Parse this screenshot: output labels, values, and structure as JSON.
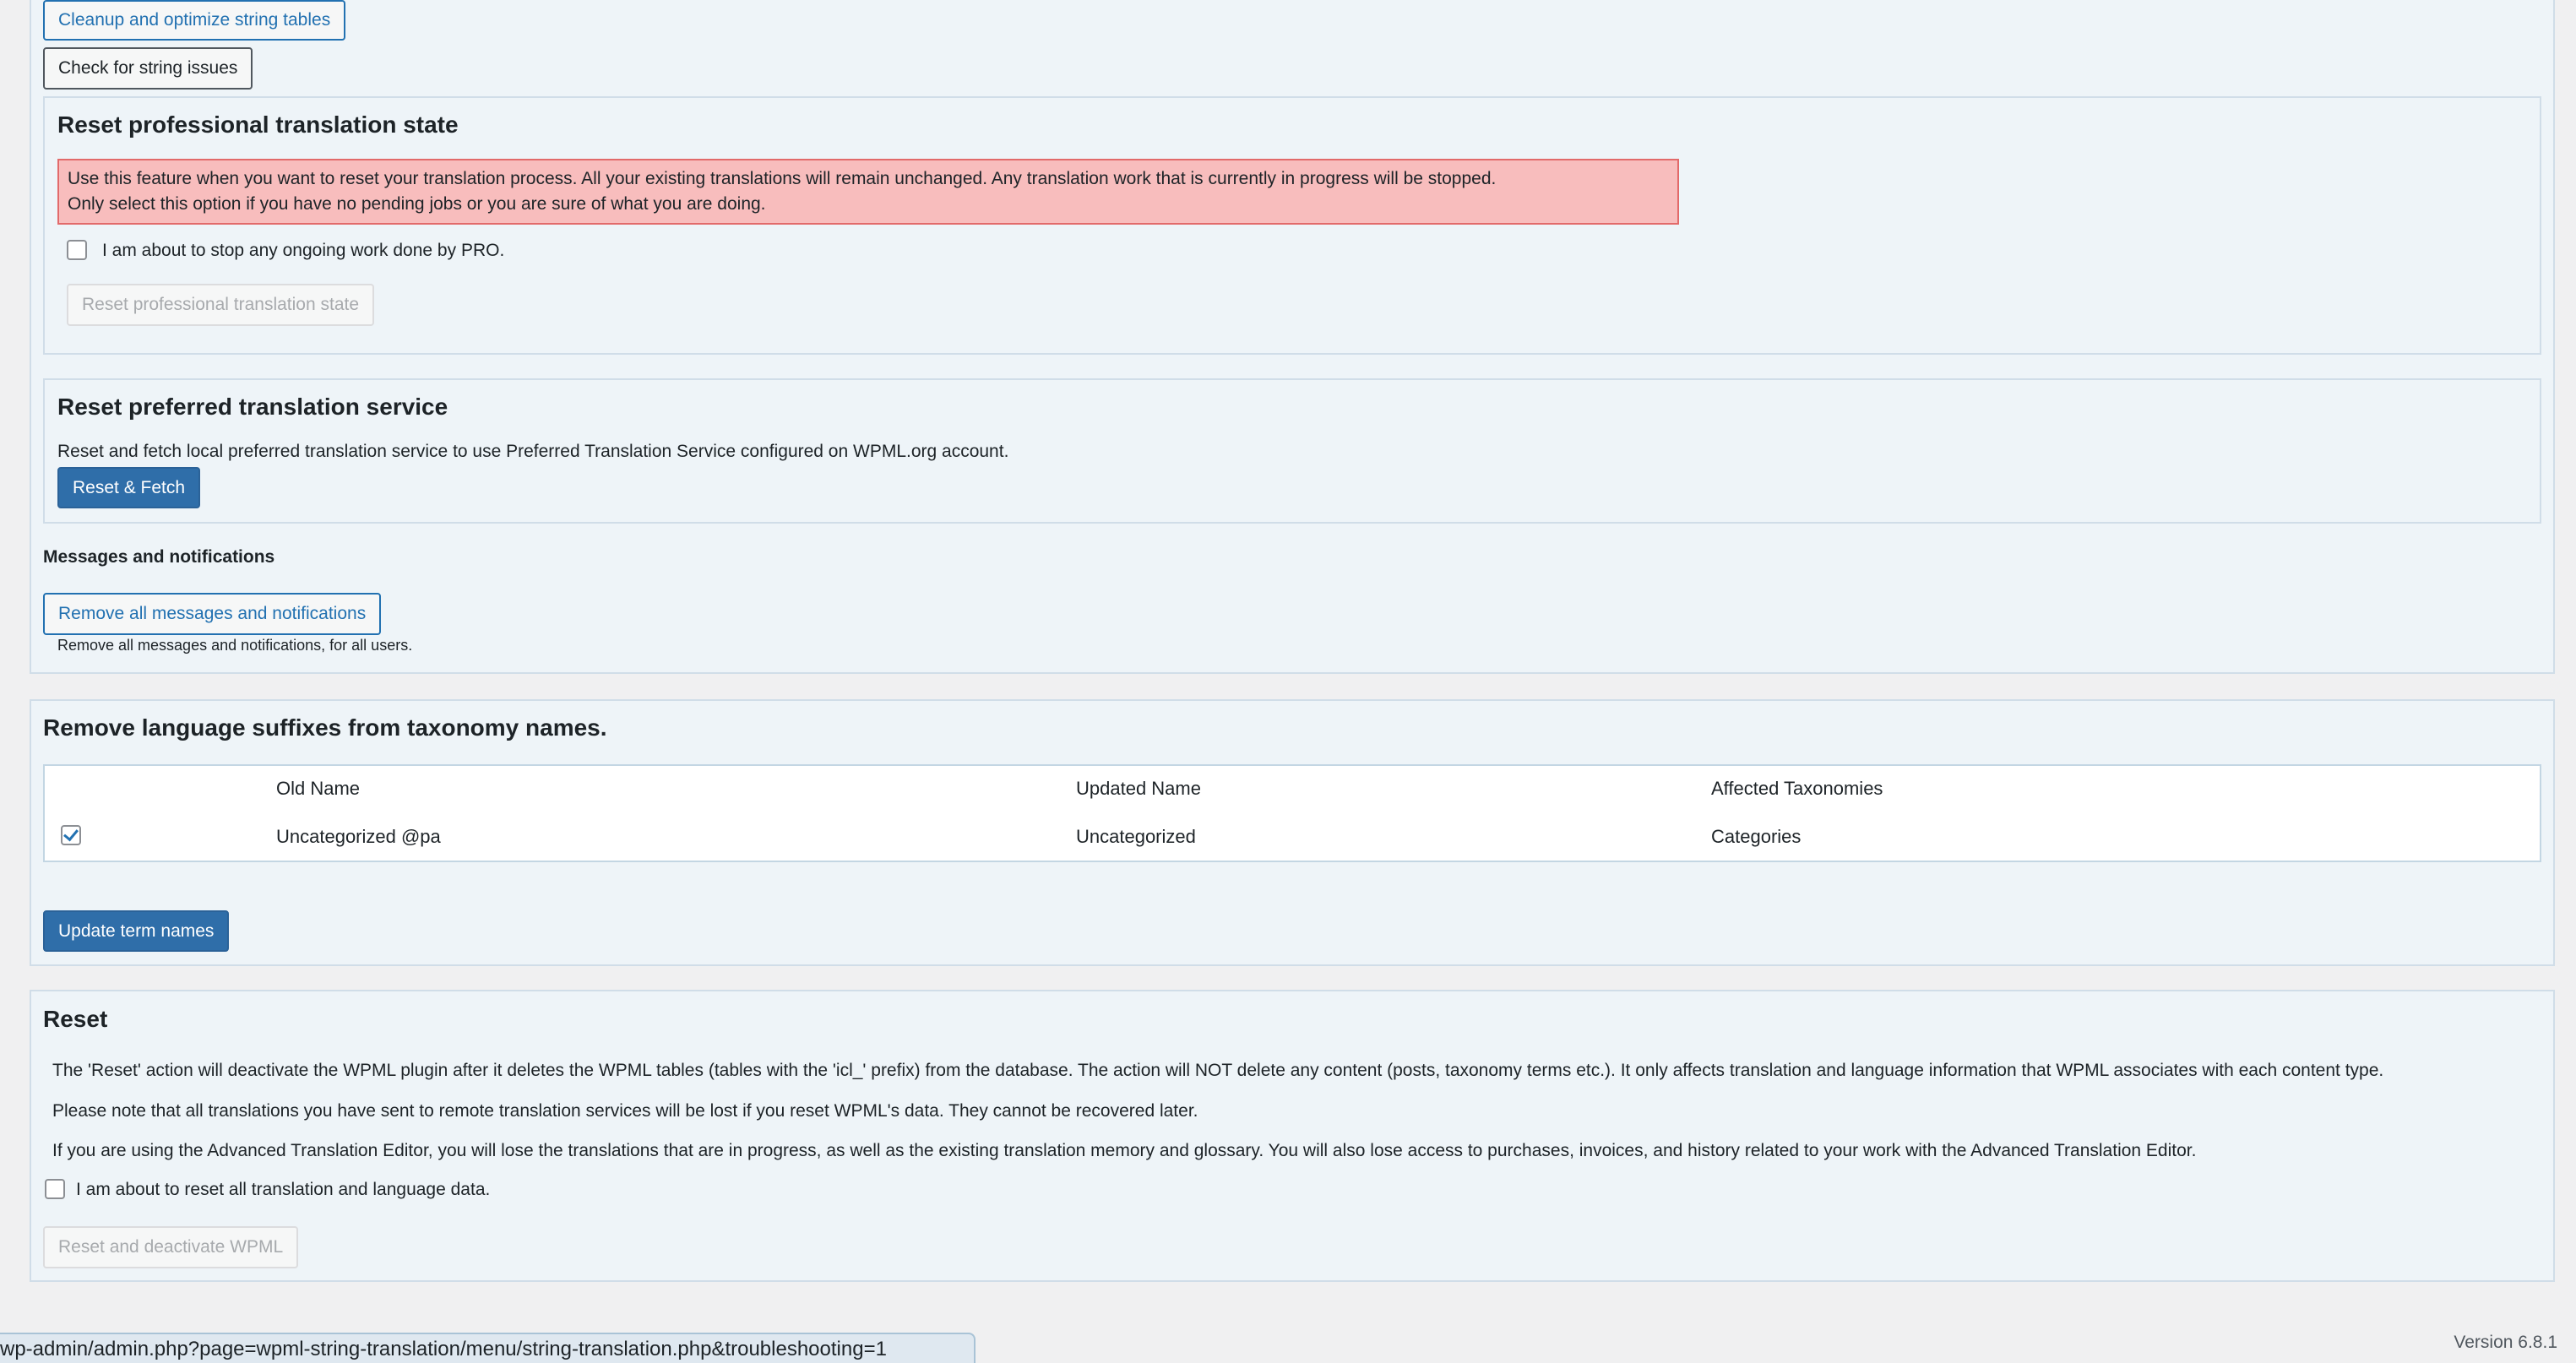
{
  "string_tools": {
    "cleanup_label": "Cleanup and optimize string tables",
    "check_label": "Check for string issues"
  },
  "reset_pro": {
    "title": "Reset professional translation state",
    "warning_line1": "Use this feature when you want to reset your translation process. All your existing translations will remain unchanged. Any translation work that is currently in progress will be stopped.",
    "warning_line2": "Only select this option if you have no pending jobs or you are sure of what you are doing.",
    "confirm_label": "I am about to stop any ongoing work done by PRO.",
    "button_label": "Reset professional translation state"
  },
  "preferred_service": {
    "title": "Reset preferred translation service",
    "description": "Reset and fetch local preferred translation service to use Preferred Translation Service configured on WPML.org account.",
    "button_label": "Reset & Fetch"
  },
  "messages": {
    "title": "Messages and notifications",
    "button_label": "Remove all messages and notifications",
    "description": "Remove all messages and notifications, for all users."
  },
  "taxonomy": {
    "title": "Remove language suffixes from taxonomy names.",
    "columns": [
      "Old Name",
      "Updated Name",
      "Affected Taxonomies"
    ],
    "rows": [
      {
        "checked": true,
        "old_name": "Uncategorized @pa",
        "updated_name": "Uncategorized",
        "taxonomies": "Categories"
      }
    ],
    "button_label": "Update term names"
  },
  "reset": {
    "title": "Reset",
    "para1": "The 'Reset' action will deactivate the WPML plugin after it deletes the WPML tables (tables with the 'icl_' prefix) from the database. The action will NOT delete any content (posts, taxonomy terms etc.). It only affects translation and language information that WPML associates with each content type.",
    "para2": "Please note that all translations you have sent to remote translation services will be lost if you reset WPML's data. They cannot be recovered later.",
    "para3": "If you are using the Advanced Translation Editor, you will lose the translations that are in progress, as well as the existing translation memory and glossary. You will also lose access to purchases, invoices, and history related to your work with the Advanced Translation Editor.",
    "confirm_label": "I am about to reset all translation and language data.",
    "button_label": "Reset and deactivate WPML"
  },
  "footer": {
    "status_url": "wp-admin/admin.php?page=wpml-string-translation/menu/string-translation.php&troubleshooting=1",
    "version": "Version 6.8.1"
  },
  "colors": {
    "accent": "#2271b1",
    "primary_button": "#2f6ea9",
    "error_notice": "#f8bdbd",
    "panel_bg": "#eef4f8"
  }
}
